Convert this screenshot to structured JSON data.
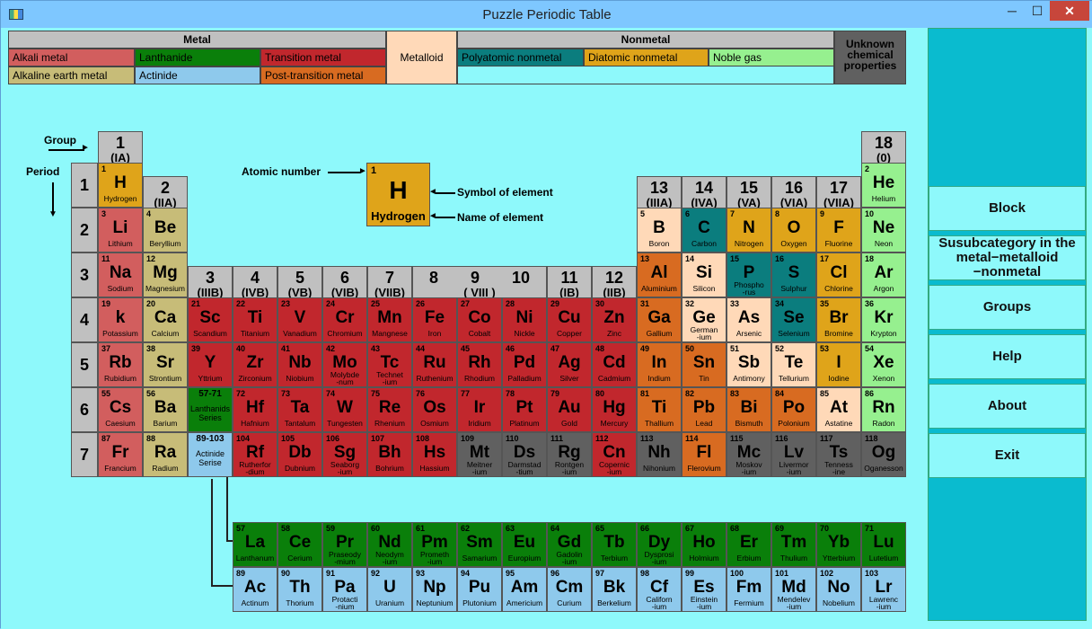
{
  "window": {
    "title": "Puzzle Periodic Table",
    "minimize": "─",
    "maximize": "☐",
    "close": "✕"
  },
  "legend": {
    "metal": "Metal",
    "nonmetal": "Nonmetal",
    "metalloid": "Metalloid",
    "unknown": "Unknown chemical properties",
    "alkali": "Alkali metal",
    "alkaline_earth": "Alkaline earth metal",
    "lanthanide": "Lanthanide",
    "actinide": "Actinide",
    "transition": "Transition metal",
    "post_transition": "Post-transition metal",
    "polyatomic": "Polyatomic nonmetal",
    "diatomic": "Diatomic nonmetal",
    "noble": "Noble gas"
  },
  "colors": {
    "alkali": "#d25e5e",
    "alkaline_earth": "#c7bc78",
    "transition": "#c1272d",
    "post_transition": "#d86b21",
    "metalloid": "#ffd9b8",
    "polyatomic": "#0b7d7e",
    "diatomic": "#dfa41a",
    "noble": "#96f08f",
    "lanthanide": "#0a7f0a",
    "actinide": "#8ec9ec",
    "unknown": "#606060"
  },
  "annotations": {
    "group": "Group",
    "period": "Period",
    "atomic_number": "Atomic number",
    "symbol": "Symbol of element",
    "name": "Name of element"
  },
  "example": {
    "num": "1",
    "sym": "H",
    "name": "Hydrogen"
  },
  "groups": [
    {
      "g": "1",
      "s": "(IA)"
    },
    {
      "g": "2",
      "s": "(IIA)"
    },
    {
      "g": "3",
      "s": "(IIIB)"
    },
    {
      "g": "4",
      "s": "(IVB)"
    },
    {
      "g": "5",
      "s": "(VB)"
    },
    {
      "g": "6",
      "s": "(VIB)"
    },
    {
      "g": "7",
      "s": "(VIIB)"
    },
    {
      "g": "8",
      "s": ""
    },
    {
      "g": "9",
      "s": "( VIII )"
    },
    {
      "g": "10",
      "s": ""
    },
    {
      "g": "11",
      "s": "(IB)"
    },
    {
      "g": "12",
      "s": "(IIB)"
    },
    {
      "g": "13",
      "s": "(IIIA)"
    },
    {
      "g": "14",
      "s": "(IVA)"
    },
    {
      "g": "15",
      "s": "(VA)"
    },
    {
      "g": "16",
      "s": "(VIA)"
    },
    {
      "g": "17",
      "s": "(VIIA)"
    },
    {
      "g": "18",
      "s": "(0)"
    }
  ],
  "periods": [
    "1",
    "2",
    "3",
    "4",
    "5",
    "6",
    "7"
  ],
  "placeholders": {
    "lanthanides": {
      "num": "57-71",
      "name": "Lanthanids\nSeries"
    },
    "actinides": {
      "num": "89-103",
      "name": "Actinide\nSerise"
    }
  },
  "elements": [
    {
      "n": "1",
      "s": "H",
      "name": "Hydrogen",
      "c": "diat",
      "p": 1,
      "g": 1
    },
    {
      "n": "2",
      "s": "He",
      "name": "Helium",
      "c": "noble",
      "p": 1,
      "g": 18
    },
    {
      "n": "3",
      "s": "Li",
      "name": "Lithium",
      "c": "alkali",
      "p": 2,
      "g": 1
    },
    {
      "n": "4",
      "s": "Be",
      "name": "Beryllium",
      "c": "alkearth",
      "p": 2,
      "g": 2
    },
    {
      "n": "5",
      "s": "B",
      "name": "Boron",
      "c": "metalloid",
      "p": 2,
      "g": 13
    },
    {
      "n": "6",
      "s": "C",
      "name": "Carbon",
      "c": "polyat",
      "p": 2,
      "g": 14
    },
    {
      "n": "7",
      "s": "N",
      "name": "Nitrogen",
      "c": "diat",
      "p": 2,
      "g": 15
    },
    {
      "n": "8",
      "s": "O",
      "name": "Oxygen",
      "c": "diat",
      "p": 2,
      "g": 16
    },
    {
      "n": "9",
      "s": "F",
      "name": "Fluorine",
      "c": "diat",
      "p": 2,
      "g": 17
    },
    {
      "n": "10",
      "s": "Ne",
      "name": "Neon",
      "c": "noble",
      "p": 2,
      "g": 18
    },
    {
      "n": "11",
      "s": "Na",
      "name": "Sodium",
      "c": "alkali",
      "p": 3,
      "g": 1
    },
    {
      "n": "12",
      "s": "Mg",
      "name": "Magnesium",
      "c": "alkearth",
      "p": 3,
      "g": 2
    },
    {
      "n": "13",
      "s": "Al",
      "name": "Aluminium",
      "c": "post",
      "p": 3,
      "g": 13
    },
    {
      "n": "14",
      "s": "Si",
      "name": "Silicon",
      "c": "metalloid",
      "p": 3,
      "g": 14
    },
    {
      "n": "15",
      "s": "P",
      "name": "Phospho\n-rus",
      "c": "polyat",
      "p": 3,
      "g": 15
    },
    {
      "n": "16",
      "s": "S",
      "name": "Sulphur",
      "c": "polyat",
      "p": 3,
      "g": 16
    },
    {
      "n": "17",
      "s": "Cl",
      "name": "Chlorine",
      "c": "diat",
      "p": 3,
      "g": 17
    },
    {
      "n": "18",
      "s": "Ar",
      "name": "Argon",
      "c": "noble",
      "p": 3,
      "g": 18
    },
    {
      "n": "19",
      "s": "k",
      "name": "Potassium",
      "c": "alkali",
      "p": 4,
      "g": 1
    },
    {
      "n": "20",
      "s": "Ca",
      "name": "Calcium",
      "c": "alkearth",
      "p": 4,
      "g": 2
    },
    {
      "n": "21",
      "s": "Sc",
      "name": "Scandium",
      "c": "trans",
      "p": 4,
      "g": 3
    },
    {
      "n": "22",
      "s": "Ti",
      "name": "Titanium",
      "c": "trans",
      "p": 4,
      "g": 4
    },
    {
      "n": "23",
      "s": "V",
      "name": "Vanadium",
      "c": "trans",
      "p": 4,
      "g": 5
    },
    {
      "n": "24",
      "s": "Cr",
      "name": "Chromium",
      "c": "trans",
      "p": 4,
      "g": 6
    },
    {
      "n": "25",
      "s": "Mn",
      "name": "Mangnese",
      "c": "trans",
      "p": 4,
      "g": 7
    },
    {
      "n": "26",
      "s": "Fe",
      "name": "Iron",
      "c": "trans",
      "p": 4,
      "g": 8
    },
    {
      "n": "27",
      "s": "Co",
      "name": "Cobalt",
      "c": "trans",
      "p": 4,
      "g": 9
    },
    {
      "n": "28",
      "s": "Ni",
      "name": "Nickle",
      "c": "trans",
      "p": 4,
      "g": 10
    },
    {
      "n": "29",
      "s": "Cu",
      "name": "Copper",
      "c": "trans",
      "p": 4,
      "g": 11
    },
    {
      "n": "30",
      "s": "Zn",
      "name": "Zinc",
      "c": "trans",
      "p": 4,
      "g": 12
    },
    {
      "n": "31",
      "s": "Ga",
      "name": "Gallium",
      "c": "post",
      "p": 4,
      "g": 13
    },
    {
      "n": "32",
      "s": "Ge",
      "name": "German\n-ium",
      "c": "metalloid",
      "p": 4,
      "g": 14
    },
    {
      "n": "33",
      "s": "As",
      "name": "Arsenic",
      "c": "metalloid",
      "p": 4,
      "g": 15
    },
    {
      "n": "34",
      "s": "Se",
      "name": "Selenium",
      "c": "polyat",
      "p": 4,
      "g": 16
    },
    {
      "n": "35",
      "s": "Br",
      "name": "Bromine",
      "c": "diat",
      "p": 4,
      "g": 17
    },
    {
      "n": "36",
      "s": "Kr",
      "name": "Krypton",
      "c": "noble",
      "p": 4,
      "g": 18
    },
    {
      "n": "37",
      "s": "Rb",
      "name": "Rubidium",
      "c": "alkali",
      "p": 5,
      "g": 1
    },
    {
      "n": "38",
      "s": "Sr",
      "name": "Strontium",
      "c": "alkearth",
      "p": 5,
      "g": 2
    },
    {
      "n": "39",
      "s": "Y",
      "name": "Yttrium",
      "c": "trans",
      "p": 5,
      "g": 3
    },
    {
      "n": "40",
      "s": "Zr",
      "name": "Zirconium",
      "c": "trans",
      "p": 5,
      "g": 4
    },
    {
      "n": "41",
      "s": "Nb",
      "name": "Niobium",
      "c": "trans",
      "p": 5,
      "g": 5
    },
    {
      "n": "42",
      "s": "Mo",
      "name": "Molybde\n-num",
      "c": "trans",
      "p": 5,
      "g": 6
    },
    {
      "n": "43",
      "s": "Tc",
      "name": "Technet\n-ium",
      "c": "trans",
      "p": 5,
      "g": 7
    },
    {
      "n": "44",
      "s": "Ru",
      "name": "Ruthenium",
      "c": "trans",
      "p": 5,
      "g": 8
    },
    {
      "n": "45",
      "s": "Rh",
      "name": "Rhodium",
      "c": "trans",
      "p": 5,
      "g": 9
    },
    {
      "n": "46",
      "s": "Pd",
      "name": "Palladium",
      "c": "trans",
      "p": 5,
      "g": 10
    },
    {
      "n": "47",
      "s": "Ag",
      "name": "Silver",
      "c": "trans",
      "p": 5,
      "g": 11
    },
    {
      "n": "48",
      "s": "Cd",
      "name": "Cadmium",
      "c": "trans",
      "p": 5,
      "g": 12
    },
    {
      "n": "49",
      "s": "In",
      "name": "Indium",
      "c": "post",
      "p": 5,
      "g": 13
    },
    {
      "n": "50",
      "s": "Sn",
      "name": "Tin",
      "c": "post",
      "p": 5,
      "g": 14
    },
    {
      "n": "51",
      "s": "Sb",
      "name": "Antimony",
      "c": "metalloid",
      "p": 5,
      "g": 15
    },
    {
      "n": "52",
      "s": "Te",
      "name": "Tellurium",
      "c": "metalloid",
      "p": 5,
      "g": 16
    },
    {
      "n": "53",
      "s": "I",
      "name": "Iodine",
      "c": "diat",
      "p": 5,
      "g": 17
    },
    {
      "n": "54",
      "s": "Xe",
      "name": "Xenon",
      "c": "noble",
      "p": 5,
      "g": 18
    },
    {
      "n": "55",
      "s": "Cs",
      "name": "Caesium",
      "c": "alkali",
      "p": 6,
      "g": 1
    },
    {
      "n": "56",
      "s": "Ba",
      "name": "Barium",
      "c": "alkearth",
      "p": 6,
      "g": 2
    },
    {
      "n": "72",
      "s": "Hf",
      "name": "Hafnium",
      "c": "trans",
      "p": 6,
      "g": 4
    },
    {
      "n": "73",
      "s": "Ta",
      "name": "Tantalum",
      "c": "trans",
      "p": 6,
      "g": 5
    },
    {
      "n": "74",
      "s": "W",
      "name": "Tungesten",
      "c": "trans",
      "p": 6,
      "g": 6
    },
    {
      "n": "75",
      "s": "Re",
      "name": "Rhenium",
      "c": "trans",
      "p": 6,
      "g": 7
    },
    {
      "n": "76",
      "s": "Os",
      "name": "Osmium",
      "c": "trans",
      "p": 6,
      "g": 8
    },
    {
      "n": "77",
      "s": "Ir",
      "name": "Iridium",
      "c": "trans",
      "p": 6,
      "g": 9
    },
    {
      "n": "78",
      "s": "Pt",
      "name": "Platinum",
      "c": "trans",
      "p": 6,
      "g": 10
    },
    {
      "n": "79",
      "s": "Au",
      "name": "Gold",
      "c": "trans",
      "p": 6,
      "g": 11
    },
    {
      "n": "80",
      "s": "Hg",
      "name": "Mercury",
      "c": "trans",
      "p": 6,
      "g": 12
    },
    {
      "n": "81",
      "s": "Ti",
      "name": "Thallium",
      "c": "post",
      "p": 6,
      "g": 13
    },
    {
      "n": "82",
      "s": "Pb",
      "name": "Lead",
      "c": "post",
      "p": 6,
      "g": 14
    },
    {
      "n": "83",
      "s": "Bi",
      "name": "Bismuth",
      "c": "post",
      "p": 6,
      "g": 15
    },
    {
      "n": "84",
      "s": "Po",
      "name": "Polonium",
      "c": "post",
      "p": 6,
      "g": 16
    },
    {
      "n": "85",
      "s": "At",
      "name": "Astatine",
      "c": "metalloid",
      "p": 6,
      "g": 17
    },
    {
      "n": "86",
      "s": "Rn",
      "name": "Radon",
      "c": "noble",
      "p": 6,
      "g": 18
    },
    {
      "n": "87",
      "s": "Fr",
      "name": "Francium",
      "c": "alkali",
      "p": 7,
      "g": 1
    },
    {
      "n": "88",
      "s": "Ra",
      "name": "Radium",
      "c": "alkearth",
      "p": 7,
      "g": 2
    },
    {
      "n": "104",
      "s": "Rf",
      "name": "Rutherfor\n-dium",
      "c": "trans",
      "p": 7,
      "g": 4
    },
    {
      "n": "105",
      "s": "Db",
      "name": "Dubnium",
      "c": "trans",
      "p": 7,
      "g": 5
    },
    {
      "n": "106",
      "s": "Sg",
      "name": "Seaborg\n-ium",
      "c": "trans",
      "p": 7,
      "g": 6
    },
    {
      "n": "107",
      "s": "Bh",
      "name": "Bohrium",
      "c": "trans",
      "p": 7,
      "g": 7
    },
    {
      "n": "108",
      "s": "Hs",
      "name": "Hassium",
      "c": "trans",
      "p": 7,
      "g": 8
    },
    {
      "n": "109",
      "s": "Mt",
      "name": "Meitner\n-ium",
      "c": "unknown",
      "p": 7,
      "g": 9
    },
    {
      "n": "110",
      "s": "Ds",
      "name": "Darmstad\n-tium",
      "c": "unknown",
      "p": 7,
      "g": 10
    },
    {
      "n": "111",
      "s": "Rg",
      "name": "Rontgen\n-ium",
      "c": "unknown",
      "p": 7,
      "g": 11
    },
    {
      "n": "112",
      "s": "Cn",
      "name": "Copernic\n-ium",
      "c": "trans",
      "p": 7,
      "g": 12
    },
    {
      "n": "113",
      "s": "Nh",
      "name": "Nihonium",
      "c": "unknown",
      "p": 7,
      "g": 13
    },
    {
      "n": "114",
      "s": "Fl",
      "name": "Flerovium",
      "c": "post",
      "p": 7,
      "g": 14
    },
    {
      "n": "115",
      "s": "Mc",
      "name": "Moskov\n-ium",
      "c": "unknown",
      "p": 7,
      "g": 15
    },
    {
      "n": "116",
      "s": "Lv",
      "name": "Livermor\n-ium",
      "c": "unknown",
      "p": 7,
      "g": 16
    },
    {
      "n": "117",
      "s": "Ts",
      "name": "Tenness\n-ine",
      "c": "unknown",
      "p": 7,
      "g": 17
    },
    {
      "n": "118",
      "s": "Og",
      "name": "Oganesson",
      "c": "unknown",
      "p": 7,
      "g": 18
    },
    {
      "n": "57",
      "s": "La",
      "name": "Lanthanum",
      "c": "lanth",
      "p": 8,
      "g": 4
    },
    {
      "n": "58",
      "s": "Ce",
      "name": "Cerium",
      "c": "lanth",
      "p": 8,
      "g": 5
    },
    {
      "n": "59",
      "s": "Pr",
      "name": "Praseody\n-mium",
      "c": "lanth",
      "p": 8,
      "g": 6
    },
    {
      "n": "60",
      "s": "Nd",
      "name": "Neodym\n-ium",
      "c": "lanth",
      "p": 8,
      "g": 7
    },
    {
      "n": "61",
      "s": "Pm",
      "name": "Prometh\n-ium",
      "c": "lanth",
      "p": 8,
      "g": 8
    },
    {
      "n": "62",
      "s": "Sm",
      "name": "Samarium",
      "c": "lanth",
      "p": 8,
      "g": 9
    },
    {
      "n": "63",
      "s": "Eu",
      "name": "Europium",
      "c": "lanth",
      "p": 8,
      "g": 10
    },
    {
      "n": "64",
      "s": "Gd",
      "name": "Gadolin\n-ium",
      "c": "lanth",
      "p": 8,
      "g": 11
    },
    {
      "n": "65",
      "s": "Tb",
      "name": "Terbium",
      "c": "lanth",
      "p": 8,
      "g": 12
    },
    {
      "n": "66",
      "s": "Dy",
      "name": "Dysprosi\n-ium",
      "c": "lanth",
      "p": 8,
      "g": 13
    },
    {
      "n": "67",
      "s": "Ho",
      "name": "Holmium",
      "c": "lanth",
      "p": 8,
      "g": 14
    },
    {
      "n": "68",
      "s": "Er",
      "name": "Erbium",
      "c": "lanth",
      "p": 8,
      "g": 15
    },
    {
      "n": "69",
      "s": "Tm",
      "name": "Thulium",
      "c": "lanth",
      "p": 8,
      "g": 16
    },
    {
      "n": "70",
      "s": "Yb",
      "name": "Ytterbium",
      "c": "lanth",
      "p": 8,
      "g": 17
    },
    {
      "n": "71",
      "s": "Lu",
      "name": "Lutetium",
      "c": "lanth",
      "p": 8,
      "g": 18
    },
    {
      "n": "89",
      "s": "Ac",
      "name": "Actinum",
      "c": "actin",
      "p": 9,
      "g": 4
    },
    {
      "n": "90",
      "s": "Th",
      "name": "Thorium",
      "c": "actin",
      "p": 9,
      "g": 5
    },
    {
      "n": "91",
      "s": "Pa",
      "name": "Protacti\n-nium",
      "c": "actin",
      "p": 9,
      "g": 6
    },
    {
      "n": "92",
      "s": "U",
      "name": "Uranium",
      "c": "actin",
      "p": 9,
      "g": 7
    },
    {
      "n": "93",
      "s": "Np",
      "name": "Neptunium",
      "c": "actin",
      "p": 9,
      "g": 8
    },
    {
      "n": "94",
      "s": "Pu",
      "name": "Plutonium",
      "c": "actin",
      "p": 9,
      "g": 9
    },
    {
      "n": "95",
      "s": "Am",
      "name": "Americium",
      "c": "actin",
      "p": 9,
      "g": 10
    },
    {
      "n": "96",
      "s": "Cm",
      "name": "Curium",
      "c": "actin",
      "p": 9,
      "g": 11
    },
    {
      "n": "97",
      "s": "Bk",
      "name": "Berkelium",
      "c": "actin",
      "p": 9,
      "g": 12
    },
    {
      "n": "98",
      "s": "Cf",
      "name": "Californ\n-ium",
      "c": "actin",
      "p": 9,
      "g": 13
    },
    {
      "n": "99",
      "s": "Es",
      "name": "Einstein\n-ium",
      "c": "actin",
      "p": 9,
      "g": 14
    },
    {
      "n": "100",
      "s": "Fm",
      "name": "Fermium",
      "c": "actin",
      "p": 9,
      "g": 15
    },
    {
      "n": "101",
      "s": "Md",
      "name": "Mendelev\n-ium",
      "c": "actin",
      "p": 9,
      "g": 16
    },
    {
      "n": "102",
      "s": "No",
      "name": "Nobelium",
      "c": "actin",
      "p": 9,
      "g": 17
    },
    {
      "n": "103",
      "s": "Lr",
      "name": "Lawrenc\n-ium",
      "c": "actin",
      "p": 9,
      "g": 18
    }
  ],
  "sidebar": {
    "block": "Block",
    "subcategory": "Susubcategory in the metal−metalloid −nonmetal",
    "groups": "Groups",
    "help": "Help",
    "about": "About",
    "exit": "Exit"
  }
}
